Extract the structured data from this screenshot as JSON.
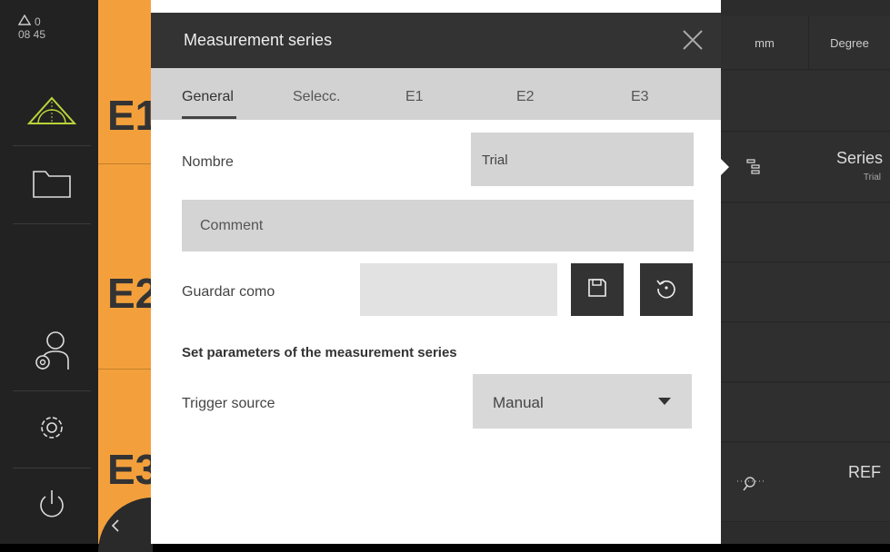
{
  "status": {
    "alert_count": "0",
    "time": "08 45"
  },
  "sidebar": {
    "items": [
      {
        "icon": "measure-icon"
      },
      {
        "icon": "folder-icon"
      },
      {
        "icon": "user-settings-icon"
      },
      {
        "icon": "gear-icon"
      },
      {
        "icon": "power-icon"
      }
    ]
  },
  "features": [
    "E1",
    "E2",
    "E3"
  ],
  "right_panel": {
    "units": [
      "mm",
      "Degree"
    ],
    "series": {
      "label": "Series",
      "sub": "Trial"
    },
    "ref": "REF"
  },
  "dialog": {
    "title": "Measurement series",
    "tabs": [
      "General",
      "Selecc.",
      "E1",
      "E2",
      "E3"
    ],
    "active_tab": "General",
    "name_label": "Nombre",
    "name_value": "Trial",
    "comment_placeholder": "Comment",
    "save_as_label": "Guardar como",
    "save_as_value": "",
    "section_title": "Set parameters of the measurement series",
    "trigger_label": "Trigger source",
    "trigger_value": "Manual"
  },
  "colors": {
    "accent": "#f3a03c",
    "sidebar": "#222222",
    "header": "#333333"
  }
}
